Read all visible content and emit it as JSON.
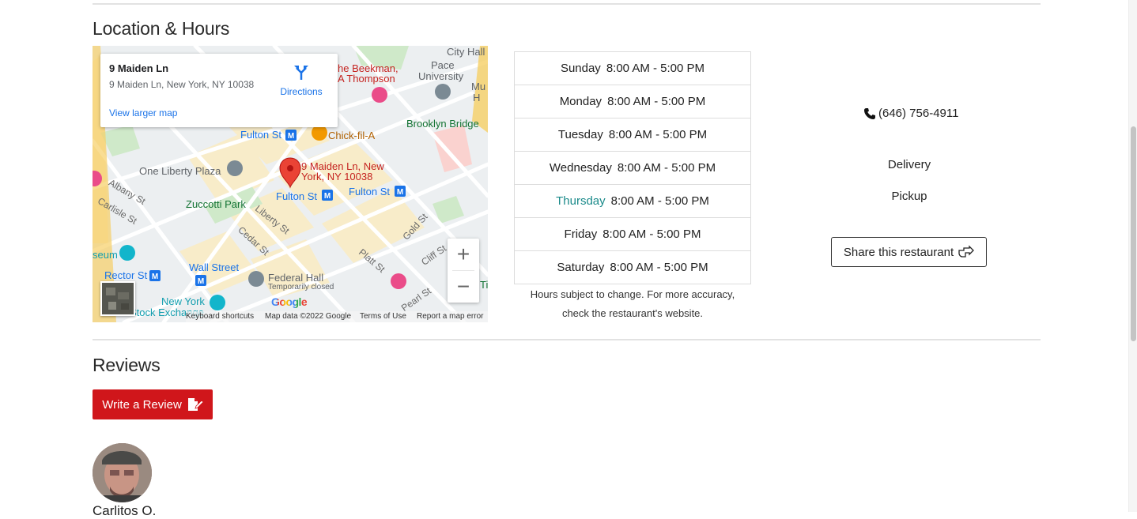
{
  "location_section": {
    "title": "Location & Hours"
  },
  "map": {
    "card": {
      "place_name": "9 Maiden Ln",
      "address": "9 Maiden Ln, New York, NY 10038",
      "directions_label": "Directions",
      "larger_map_label": "View larger map"
    },
    "pin_label_line1": "9 Maiden Ln, New",
    "pin_label_line2": "York, NY 10038",
    "labels": {
      "city_hall": "City Hall",
      "beekman_1": "he Beekman,",
      "beekman_2": "A Thompson",
      "pace_1": "Pace",
      "pace_2": "University",
      "mu": "Mu",
      "ha": "H",
      "brooklyn_bridge": "Brooklyn Bridge",
      "fulton_st_1": "Fulton St",
      "chick_fil_a": "Chick-fil-A",
      "one_liberty": "One Liberty Plaza",
      "fulton_st_2": "Fulton St",
      "fulton_st_3": "Fulton St",
      "albany": "Albany St",
      "carlisle": "Carlisle St",
      "zuccotti": "Zuccotti Park",
      "liberty": "Liberty St",
      "cedar": "Cedar St",
      "gold": "Gold St",
      "platt": "Platt St",
      "cliff": "Cliff St",
      "seum": "seum",
      "rector": "Rector St",
      "wall_street": "Wall Street",
      "federal_hall": "Federal Hall",
      "temp_closed": "Temporarily closed",
      "ny_1": "New York",
      "ny_2": "Stock Exchange",
      "pearl": "Pearl St",
      "ti": "Ti"
    },
    "zoom_in": "+",
    "zoom_out": "−",
    "google": "Google",
    "footer": {
      "shortcuts": "Keyboard shortcuts",
      "map_data": "Map data ©2022 Google",
      "terms": "Terms of Use",
      "report": "Report a map error"
    }
  },
  "hours": {
    "rows": [
      {
        "day": "Sunday",
        "time": "8:00 AM - 5:00 PM"
      },
      {
        "day": "Monday",
        "time": "8:00 AM - 5:00 PM"
      },
      {
        "day": "Tuesday",
        "time": "8:00 AM - 5:00 PM"
      },
      {
        "day": "Wednesday",
        "time": "8:00 AM - 5:00 PM"
      },
      {
        "day": "Thursday",
        "time": "8:00 AM - 5:00 PM"
      },
      {
        "day": "Friday",
        "time": "8:00 AM - 5:00 PM"
      },
      {
        "day": "Saturday",
        "time": "8:00 AM - 5:00 PM"
      }
    ],
    "note_line1": "Hours subject to change. For more accuracy,",
    "note_line2": "check the restaurant's website."
  },
  "info": {
    "phone": "(646) 756-4911",
    "services": [
      "Delivery",
      "Pickup"
    ],
    "share_label": "Share this restaurant"
  },
  "reviews": {
    "title": "Reviews",
    "write_review_label": "Write a Review",
    "first_reviewer": "Carlitos O."
  },
  "colors": {
    "brand_red": "#d0161b",
    "today_teal": "#1a8a8a",
    "link_blue": "#1a73e8"
  }
}
